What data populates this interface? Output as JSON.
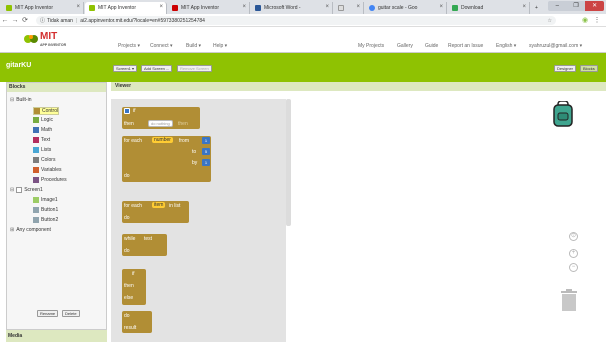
{
  "browser": {
    "tabs": [
      {
        "label": "MIT App Inventor",
        "color": "#8fc202"
      },
      {
        "label": "MIT App Inventor",
        "color": "#8fc202"
      },
      {
        "label": "MIT App Inventor",
        "color": "#cc0000"
      },
      {
        "label": "Microsoft Word - ",
        "color": "#2b5797"
      },
      {
        "label": "guitar scale - Goo",
        "color": "#4285f4"
      },
      {
        "label": "Download",
        "color": "#34a853"
      }
    ],
    "tab_close": "×",
    "new_tab": "+",
    "window_controls": [
      "–",
      "❐",
      "✕"
    ],
    "security_label": "Tidak aman",
    "url": "ai2.appinventor.mit.edu/?locale=en#5973380251254784"
  },
  "app": {
    "logo_text": "MIT",
    "logo_sub": "APP INVENTOR",
    "menu": [
      {
        "label": "Projects ▾"
      },
      {
        "label": "Connect ▾"
      },
      {
        "label": "Build ▾"
      },
      {
        "label": "Help ▾"
      }
    ],
    "right_menu": [
      {
        "label": "My Projects"
      },
      {
        "label": "Gallery"
      },
      {
        "label": "Guide"
      },
      {
        "label": "Report an Issue"
      },
      {
        "label": "English ▾"
      },
      {
        "label": "syahruzul@gmail.com ▾"
      }
    ]
  },
  "project": {
    "name": "gitarKU",
    "screen_select": "Screen1 ▾",
    "add_screen": "Add Screen ...",
    "remove_screen": "Remove Screen",
    "designer": "Designer",
    "blocks": "Blocks"
  },
  "blocks_panel": {
    "title": "Blocks",
    "builtin_label": "Built-in",
    "builtin": [
      {
        "label": "Control",
        "color": "#b18e35"
      },
      {
        "label": "Logic",
        "color": "#77ab41"
      },
      {
        "label": "Math",
        "color": "#3f71b5"
      },
      {
        "label": "Text",
        "color": "#b32d5e"
      },
      {
        "label": "Lists",
        "color": "#49a6d4"
      },
      {
        "label": "Colors",
        "color": "#7d7d7d"
      },
      {
        "label": "Variables",
        "color": "#d05f2d"
      },
      {
        "label": "Procedures",
        "color": "#7c5385"
      }
    ],
    "screen_label": "Screen1",
    "components": [
      {
        "label": "Image1"
      },
      {
        "label": "Button1"
      },
      {
        "label": "Button2"
      }
    ],
    "any_component": "Any component",
    "rename": "Rename",
    "delete": "Delete",
    "media": "Media"
  },
  "viewer": {
    "title": "Viewer",
    "blocks": {
      "if": "if",
      "then": "then",
      "foreach_number": "for each",
      "number_var": "number",
      "from": "from",
      "to": "to",
      "by": "by",
      "do": "do",
      "from_val": "1",
      "to_val": "5",
      "by_val": "1",
      "foreach_item": "for each",
      "item_var": "item",
      "in_list": "in list",
      "while": "while",
      "test": "test",
      "if2": "if",
      "then2": "then",
      "else": "else",
      "result": "result",
      "faded_hint": "do nothing"
    }
  }
}
